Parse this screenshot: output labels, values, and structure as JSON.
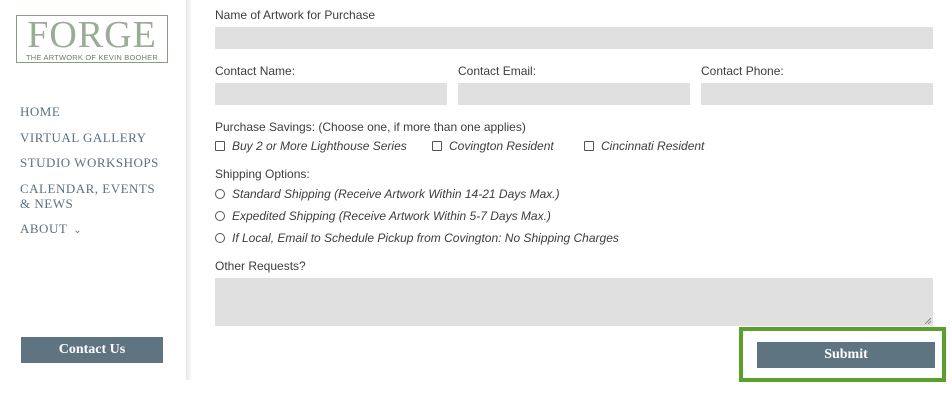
{
  "brand": {
    "logo_title": "FORGE",
    "logo_subtitle": "THE ARTWORK OF KEVIN BOOHER"
  },
  "nav": {
    "items": [
      {
        "label": "HOME"
      },
      {
        "label": "VIRTUAL GALLERY"
      },
      {
        "label": "STUDIO WORKSHOPS"
      },
      {
        "label": "CALENDAR, EVENTS & NEWS"
      },
      {
        "label": "ABOUT"
      }
    ],
    "about_chevron": "⌄",
    "contact_button": "Contact Us"
  },
  "form": {
    "artwork_label": "Name of Artwork for Purchase",
    "artwork_value": "",
    "contact_name_label": "Contact Name:",
    "contact_name_value": "",
    "contact_email_label": "Contact Email:",
    "contact_email_value": "",
    "contact_phone_label": "Contact Phone:",
    "contact_phone_value": "",
    "savings_label": "Purchase Savings: (Choose one, if more than one applies)",
    "savings_options": [
      {
        "label": "Buy 2 or More Lighthouse Series",
        "checked": false
      },
      {
        "label": "Covington Resident",
        "checked": false
      },
      {
        "label": "Cincinnati Resident",
        "checked": false
      }
    ],
    "shipping_label": "Shipping Options:",
    "shipping_options": [
      {
        "label": "Standard Shipping (Receive Artwork Within 14-21 Days Max.)",
        "selected": false
      },
      {
        "label": "Expedited Shipping (Receive Artwork Within 5-7 Days Max.)",
        "selected": false
      },
      {
        "label": "If Local, Email to Schedule Pickup from Covington: No Shipping Charges",
        "selected": false
      }
    ],
    "other_requests_label": "Other Requests?",
    "other_requests_value": "",
    "submit_label": "Submit"
  },
  "colors": {
    "field_bg": "#e0e0e0",
    "button_bg": "#5e7480",
    "highlight_border": "#5aa02c",
    "logo_green": "#9aab97",
    "nav_text": "#5b7080"
  }
}
